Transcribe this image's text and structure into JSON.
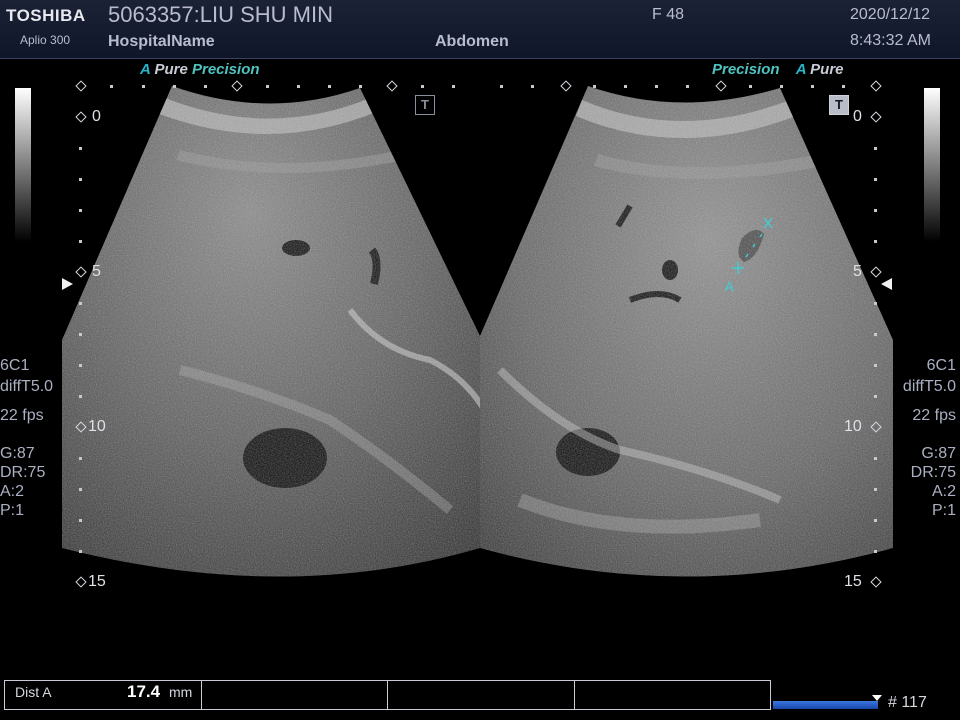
{
  "header": {
    "brand": "TOSHIBA",
    "model": "Aplio 300",
    "patient": "5063357:LIU SHU MIN",
    "hospital": "HospitalName",
    "exam": "Abdomen",
    "sex_age": "F 48",
    "date": "2020/12/12",
    "time": "8:43:32 AM"
  },
  "left_panel": {
    "brand_a": "A",
    "brand_pure": "Pure",
    "brand_precision": "Precision",
    "t_icon": "T",
    "depth_labels": [
      "0",
      "5",
      "10",
      "15"
    ]
  },
  "right_panel": {
    "brand_precision": "Precision",
    "brand_a": "A",
    "brand_pure": "Pure",
    "t_icon": "T",
    "depth_labels": [
      "0",
      "5",
      "10",
      "15"
    ],
    "caliper_label": "A"
  },
  "left_params": {
    "probe": "6C1",
    "mode": "diffT5.0",
    "fps": "22 fps",
    "gain": "G:87",
    "dr": "DR:75",
    "a": "A:2",
    "p": "P:1"
  },
  "right_params": {
    "probe": "6C1",
    "mode": "diffT5.0",
    "fps": "22 fps",
    "gain": "G:87",
    "dr": "DR:75",
    "a": "A:2",
    "p": "P:1"
  },
  "measurement": {
    "label": "Dist A",
    "value": "17.4",
    "unit": "mm"
  },
  "cine": {
    "frame": "# 117",
    "progress": 1.0
  },
  "colors": {
    "accent_cyan": "#28b4c8",
    "header_bg": "#1b2236",
    "cine_bar": "#2a5fcf"
  }
}
